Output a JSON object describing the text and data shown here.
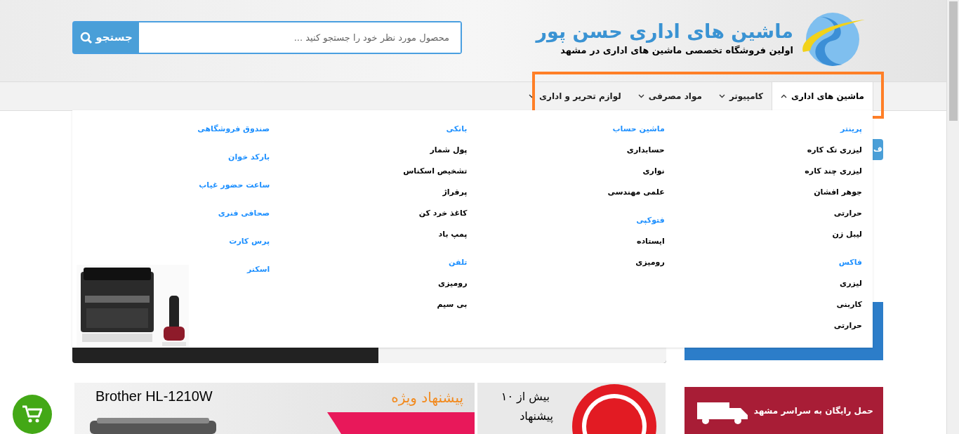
{
  "header": {
    "logo_title": "ماشین های اداری حسن پور",
    "tagline": "اولین فروشگاه تخصصی ماشین های اداری در مشهد"
  },
  "search": {
    "placeholder": "محصول مورد نظر خود را جستجو کنید ...",
    "button": "جستجو"
  },
  "nav": [
    {
      "label": "ماشین های اداری",
      "selected": true,
      "expanded": true
    },
    {
      "label": "کامپیوتر",
      "selected": false,
      "expanded": false
    },
    {
      "label": "مواد مصرفی",
      "selected": false,
      "expanded": false
    },
    {
      "label": "لوازم تحریر و اداری",
      "selected": false,
      "expanded": false
    }
  ],
  "menu": {
    "columns": [
      {
        "groups": [
          {
            "title": "پرینتر",
            "items": [
              "لیزری تک کاره",
              "لیزری چند کاره",
              "جوهر افشان",
              "حرارتی",
              "لیبل زن"
            ]
          },
          {
            "title": "فاکس",
            "items": [
              "لیزری",
              "کاربنی",
              "حرارتی"
            ]
          }
        ]
      },
      {
        "groups": [
          {
            "title": "ماشین حساب",
            "items": [
              "حسابداری",
              "نواری",
              "علمی مهندسی"
            ]
          },
          {
            "title": "فتوکپی",
            "items": [
              "ایستاده",
              "رومیزی"
            ]
          }
        ]
      },
      {
        "groups": [
          {
            "title": "بانکی",
            "items": [
              "پول شمار",
              "تشخیص اسکناس",
              "پرفراژ",
              "کاغذ خرد کن",
              "پمپ باد"
            ]
          },
          {
            "title": "تلفن",
            "items": [
              "رومیزی",
              "بی سیم"
            ]
          }
        ]
      },
      {
        "groups": [
          {
            "title": "صندوق فروشگاهی"
          },
          {
            "title": "بارکد خوان"
          },
          {
            "title": "ساعت حضور غیاب"
          },
          {
            "title": "صحافی فنری"
          },
          {
            "title": "پرس کارت"
          },
          {
            "title": "اسکنر"
          }
        ]
      }
    ]
  },
  "side_tab": {
    "label": "ف"
  },
  "promo": {
    "product": "Brother HL-1210W",
    "offer": "پیشنهاد ویژه",
    "top_line1": "بیش از ۱۰",
    "top_line2": "پیشنهاد"
  },
  "delivery_banner": {
    "text": "حمل رایگان به سراسر مشهد"
  }
}
